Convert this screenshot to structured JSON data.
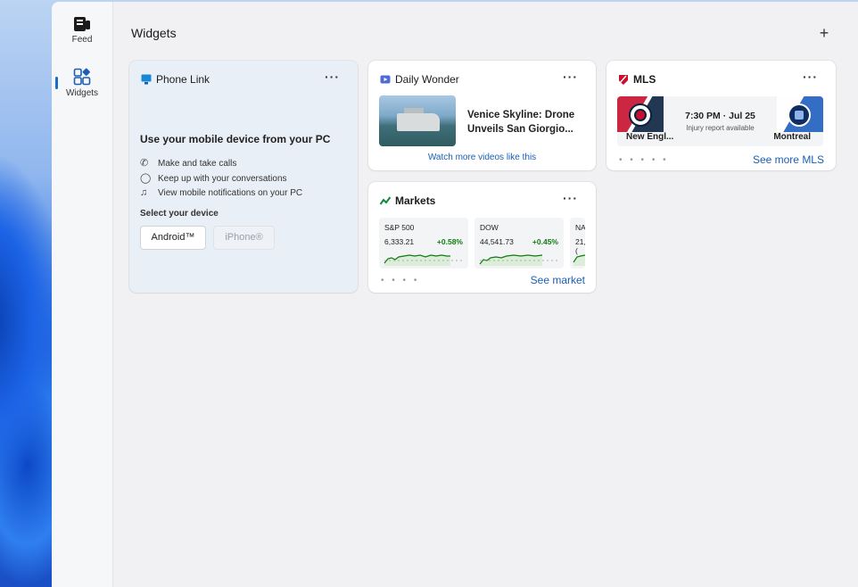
{
  "rail": {
    "feed_label": "Feed",
    "widgets_label": "Widgets"
  },
  "header": {
    "title": "Widgets",
    "add_symbol": "+"
  },
  "phone_link": {
    "title": "Phone Link",
    "more": "···",
    "headline": "Use your mobile device from your PC",
    "features": [
      {
        "icon": "phone-icon",
        "text": "Make and take calls"
      },
      {
        "icon": "chat-icon",
        "text": "Keep up with your conversations"
      },
      {
        "icon": "bell-icon",
        "text": "View mobile notifications on your PC"
      }
    ],
    "select_label": "Select your device",
    "android": "Android™",
    "iphone": "iPhone®"
  },
  "daily_wonder": {
    "title": "Daily Wonder",
    "more": "···",
    "video_title": "Venice Skyline: Drone Unveils San Giorgio...",
    "watch_more": "Watch more videos like this"
  },
  "mls": {
    "title": "MLS",
    "more": "···",
    "home_team": "New Engl...",
    "away_team": "Montreal",
    "time": "7:30 PM · Jul 25",
    "note": "Injury report available",
    "dots": "• • • • •",
    "see_more": "See more MLS"
  },
  "markets": {
    "title": "Markets",
    "more": "···",
    "tiles": [
      {
        "name": "S&P 500",
        "value": "6,333.21",
        "change": "+0.58%"
      },
      {
        "name": "DOW",
        "value": "44,541.73",
        "change": "+0.45%"
      },
      {
        "name": "NA",
        "value": "21,(",
        "change": ""
      }
    ],
    "dots": "• • • •",
    "see_market": "See market"
  },
  "colors": {
    "accent": "#1a5fb4",
    "positive": "#107c10"
  }
}
